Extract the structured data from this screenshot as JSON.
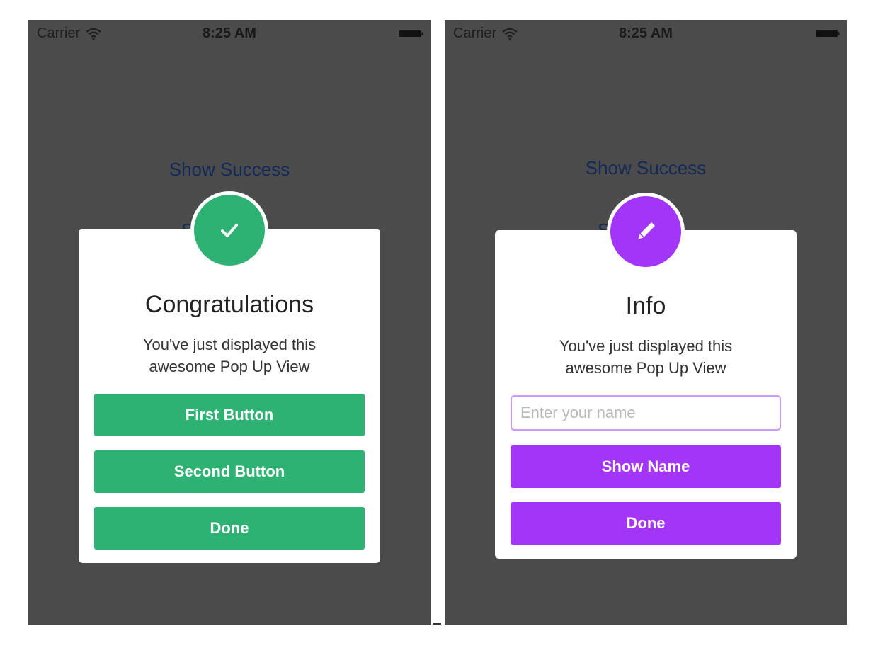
{
  "colors": {
    "overlay": "#4b4b4b",
    "success": "#2eb273",
    "info": "#a235f8",
    "link": "#12295a",
    "input_border": "#c79af7"
  },
  "status_bar": {
    "carrier": "Carrier",
    "time": "8:25 AM"
  },
  "screens": [
    {
      "background_link": "Show Success",
      "background_link_partial": "S",
      "popup": {
        "icon": "checkmark-icon",
        "title": "Congratulations",
        "message": "You've just displayed this awesome Pop Up View",
        "buttons": [
          "First Button",
          "Second Button",
          "Done"
        ]
      }
    },
    {
      "background_link": "Show Success",
      "background_link_partial": "S",
      "popup": {
        "icon": "pencil-icon",
        "title": "Info",
        "message": "You've just displayed this awesome Pop Up View",
        "input_placeholder": "Enter your name",
        "input_value": "",
        "buttons": [
          "Show Name",
          "Done"
        ]
      }
    }
  ]
}
